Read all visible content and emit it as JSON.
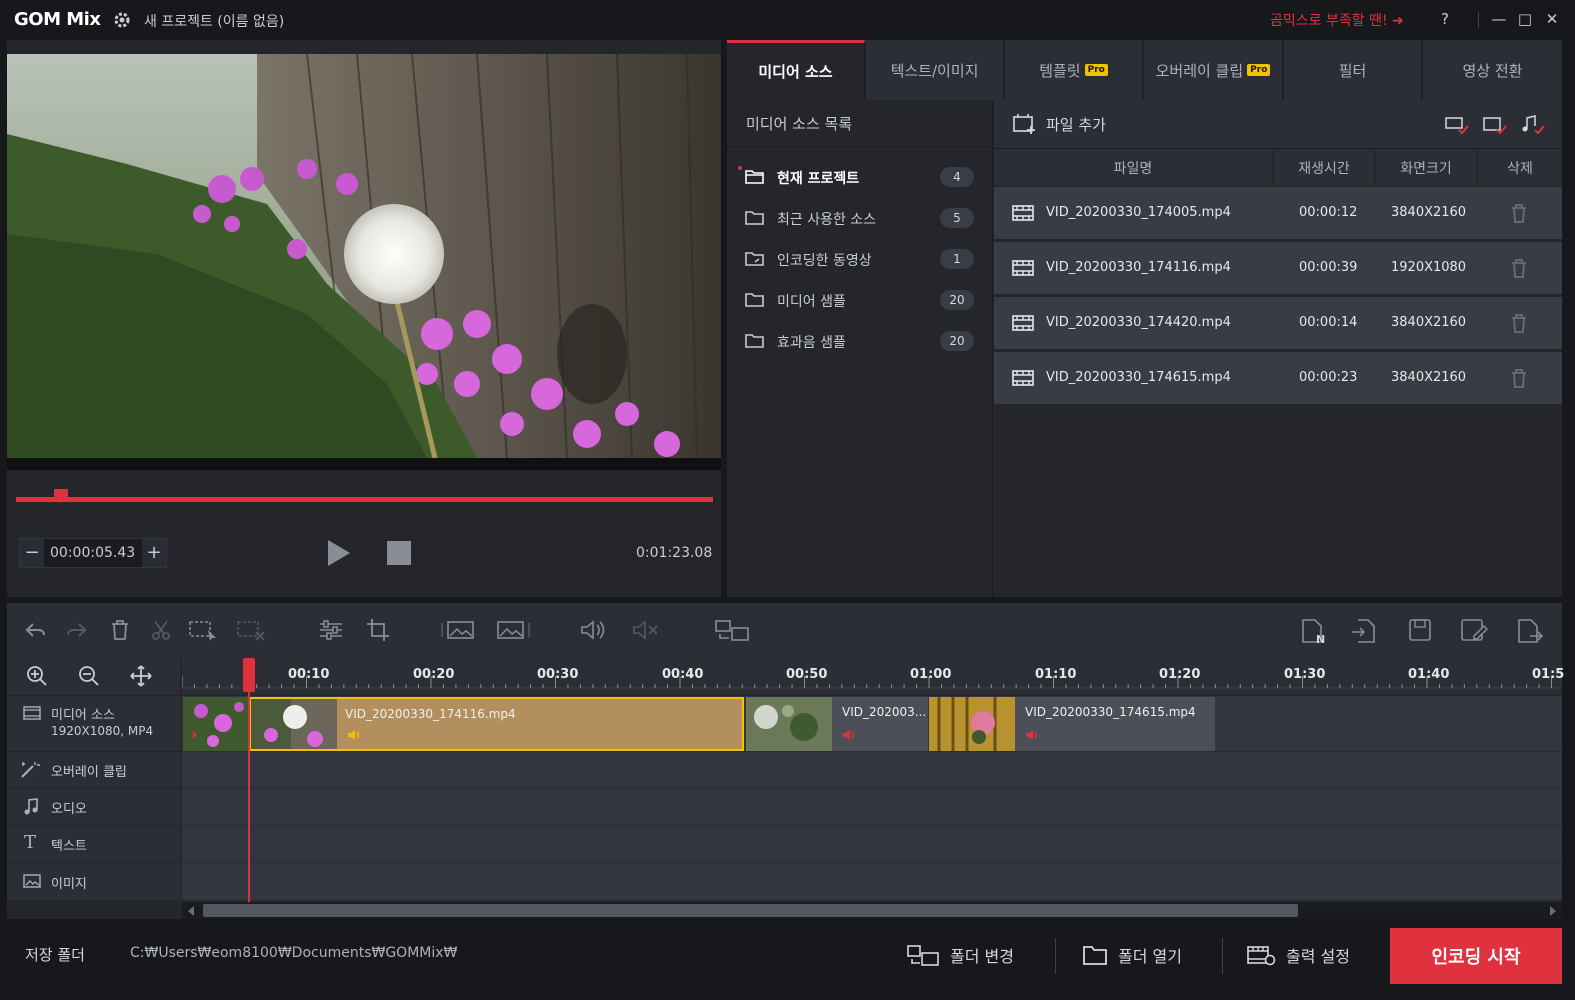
{
  "titlebar": {
    "logo": "GOM Mix",
    "project_title": "새 프로젝트 (이름 없음)",
    "promo": "곰믹스로 부족할 땐! ➜",
    "help": "?",
    "minimize": "—",
    "maximize": "□",
    "close": "✕"
  },
  "player": {
    "current_time": "00:00:05.43",
    "total_time": "0:01:23.08",
    "progress": 0.065
  },
  "tabs": [
    {
      "label": "미디어 소스",
      "pro": ""
    },
    {
      "label": "텍스트/이미지",
      "pro": ""
    },
    {
      "label": "템플릿",
      "pro": "Pro"
    },
    {
      "label": "오버레이 클립",
      "pro": "Pro"
    },
    {
      "label": "필터",
      "pro": ""
    },
    {
      "label": "영상 전환",
      "pro": ""
    }
  ],
  "source_list": {
    "heading": "미디어 소스 목록",
    "items": [
      {
        "label": "현재 프로젝트",
        "count": "4"
      },
      {
        "label": "최근 사용한 소스",
        "count": "5"
      },
      {
        "label": "인코딩한 동영상",
        "count": "1"
      },
      {
        "label": "미디어 샘플",
        "count": "20"
      },
      {
        "label": "효과음 샘플",
        "count": "20"
      }
    ]
  },
  "file_panel": {
    "add_file": "파일 추가",
    "columns": [
      "파일명",
      "재생시간",
      "화면크기",
      "삭제"
    ],
    "rows": [
      {
        "name": "VID_20200330_174005.mp4",
        "duration": "00:00:12",
        "size": "3840X2160"
      },
      {
        "name": "VID_20200330_174116.mp4",
        "duration": "00:00:39",
        "size": "1920X1080"
      },
      {
        "name": "VID_20200330_174420.mp4",
        "duration": "00:00:14",
        "size": "3840X2160"
      },
      {
        "name": "VID_20200330_174615.mp4",
        "duration": "00:00:23",
        "size": "3840X2160"
      }
    ]
  },
  "timeline": {
    "ruler": [
      "00:10",
      "00:20",
      "00:30",
      "00:40",
      "00:50",
      "01:00",
      "01:10",
      "01:20",
      "01:30",
      "01:40",
      "01:5"
    ],
    "tracks": {
      "media_name": "미디어 소스",
      "media_info": "1920X1080, MP4",
      "overlay": "오버레이 클립",
      "audio": "오디오",
      "text": "텍스트",
      "image": "이미지"
    },
    "clips": [
      {
        "name": ""
      },
      {
        "name": "VID_20200330_174116.mp4"
      },
      {
        "name": "VID_202003..."
      },
      {
        "name": "VID_20200330_174615.mp4"
      }
    ]
  },
  "footer": {
    "save_folder_label": "저장 폴더",
    "save_path": "C:₩Users₩eom8100₩Documents₩GOMMix₩",
    "change_folder": "폴더 변경",
    "open_folder": "폴더 열기",
    "output_settings": "출력 설정",
    "start_encoding": "인코딩 시작"
  },
  "colors": {
    "accent": "#e0313f",
    "pro_badge": "#f2c200",
    "selected_clip": "#b48f5e"
  }
}
